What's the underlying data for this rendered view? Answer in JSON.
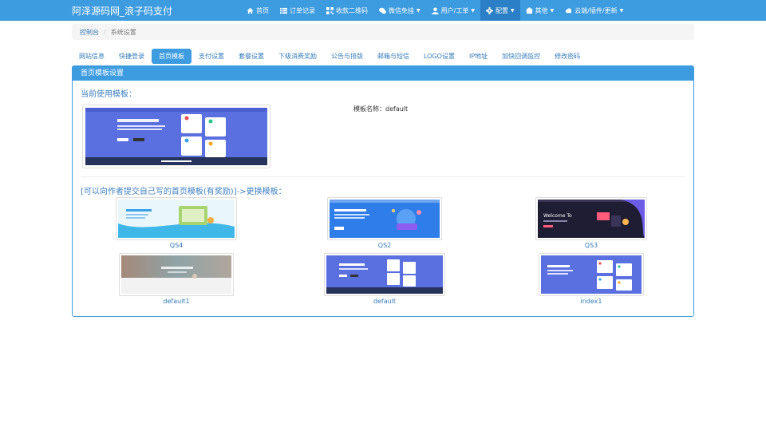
{
  "navbar": {
    "brand": "阿泽源码网_浪子码支付",
    "items": [
      {
        "label": "首页",
        "icon": "home-icon",
        "dropdown": false,
        "active": false
      },
      {
        "label": "订单记录",
        "icon": "list-icon",
        "dropdown": false,
        "active": false
      },
      {
        "label": "收款二维码",
        "icon": "qrcode-icon",
        "dropdown": false,
        "active": false
      },
      {
        "label": "微信免挂",
        "icon": "wechat-icon",
        "dropdown": true,
        "active": false
      },
      {
        "label": "用户/工单",
        "icon": "user-icon",
        "dropdown": true,
        "active": false
      },
      {
        "label": "配置",
        "icon": "gear-icon",
        "dropdown": true,
        "active": true
      },
      {
        "label": "其他",
        "icon": "puzzle-icon",
        "dropdown": true,
        "active": false
      },
      {
        "label": "云端/插件/更新",
        "icon": "cloud-icon",
        "dropdown": true,
        "active": false
      }
    ]
  },
  "breadcrumb": {
    "home": "控制台",
    "current": "系统设置"
  },
  "tabs": [
    {
      "label": "网站信息",
      "active": false
    },
    {
      "label": "快捷登录",
      "active": false
    },
    {
      "label": "首页模板",
      "active": true
    },
    {
      "label": "支付设置",
      "active": false
    },
    {
      "label": "套餐设置",
      "active": false
    },
    {
      "label": "下级消费奖励",
      "active": false
    },
    {
      "label": "公告与排版",
      "active": false
    },
    {
      "label": "邮箱与短信",
      "active": false
    },
    {
      "label": "LOGO设置",
      "active": false
    },
    {
      "label": "IP地址",
      "active": false
    },
    {
      "label": "加快回调监控",
      "active": false
    },
    {
      "label": "修改密码",
      "active": false
    }
  ],
  "panel": {
    "title": "首页模板设置",
    "current_label": "当前使用模板：",
    "template_name_label": "模板名称：default",
    "change_label": "[可以向作者提交自己写的首页模板(有奖励)]->更换模板："
  },
  "templates": [
    {
      "name": "QS4"
    },
    {
      "name": "QS2"
    },
    {
      "name": "QS3"
    },
    {
      "name": "default1"
    },
    {
      "name": "default"
    },
    {
      "name": "index1"
    }
  ],
  "colors": {
    "primary": "#3d9be0",
    "active": "#2a7fc6",
    "link": "#337ab7"
  }
}
